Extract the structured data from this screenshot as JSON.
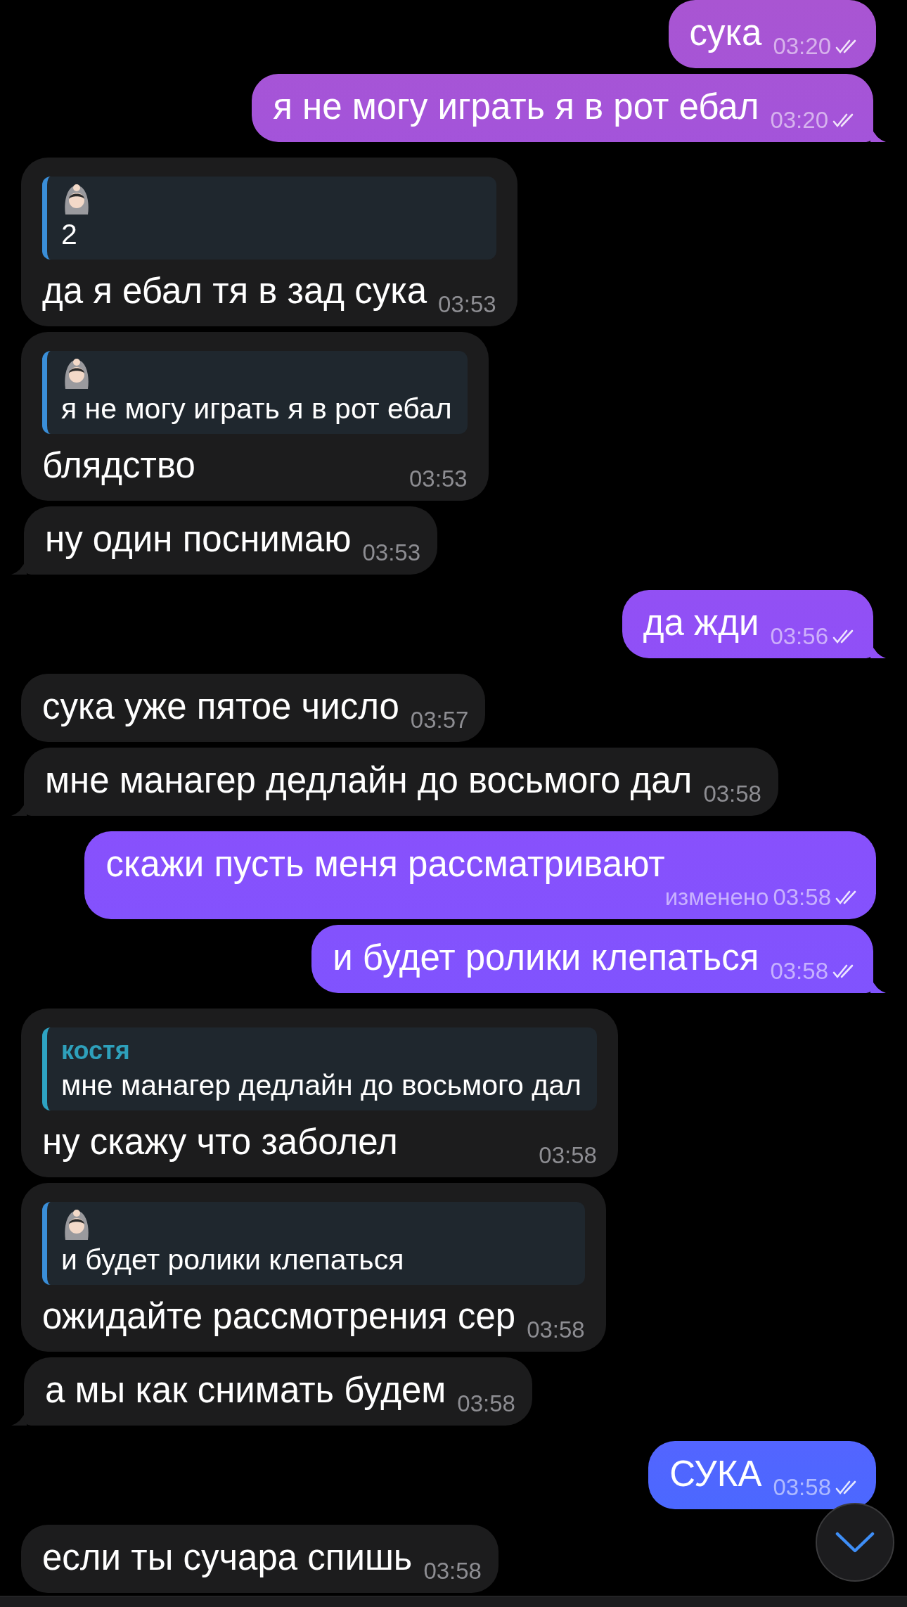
{
  "messages": [
    {
      "outgoing": true,
      "text": "сука",
      "time": "03:20",
      "read": true,
      "tail": false
    },
    {
      "outgoing": true,
      "text": "я не могу играть я в рот ебал",
      "time": "03:20",
      "read": true,
      "tail": true
    },
    {
      "outgoing": false,
      "reply": {
        "kind": "emoji_author",
        "text": "2"
      },
      "text": "да я ебал тя в зад сука",
      "time": "03:53",
      "tail": false
    },
    {
      "outgoing": false,
      "reply": {
        "kind": "emoji_author",
        "text": "я не могу играть я в рот ебал"
      },
      "text": "блядство",
      "time": "03:53",
      "tail": false
    },
    {
      "outgoing": false,
      "text": "ну один поснимаю",
      "time": "03:53",
      "tail": true
    },
    {
      "outgoing": true,
      "text": "да жди",
      "time": "03:56",
      "read": true,
      "tail": true
    },
    {
      "outgoing": false,
      "text": "сука уже пятое число",
      "time": "03:57",
      "tail": false
    },
    {
      "outgoing": false,
      "text": "мне манагер дедлайн до восьмого дал",
      "time": "03:58",
      "tail": true
    },
    {
      "outgoing": true,
      "text": "скажи пусть меня рассматривают",
      "edited_label": "изменено",
      "time": "03:58",
      "read": true,
      "tail": false
    },
    {
      "outgoing": true,
      "text": "и будет ролики клепаться",
      "time": "03:58",
      "read": true,
      "tail": true
    },
    {
      "outgoing": false,
      "reply": {
        "kind": "named_author",
        "author": "костя",
        "text": "мне манагер дедлайн до восьмого дал"
      },
      "text": "ну скажу что заболел",
      "time": "03:58",
      "tail": false
    },
    {
      "outgoing": false,
      "reply": {
        "kind": "emoji_author",
        "text": "и будет ролики клепаться"
      },
      "text": "ожидайте рассмотрения сер",
      "time": "03:58",
      "tail": false
    },
    {
      "outgoing": false,
      "text": "а мы как снимать будем",
      "time": "03:58",
      "tail": true
    },
    {
      "outgoing": true,
      "text": "СУКА",
      "time": "03:58",
      "read": true,
      "tail": false
    },
    {
      "outgoing": false,
      "text": "если ты сучара спишь",
      "time": "03:58",
      "tail": false
    }
  ]
}
